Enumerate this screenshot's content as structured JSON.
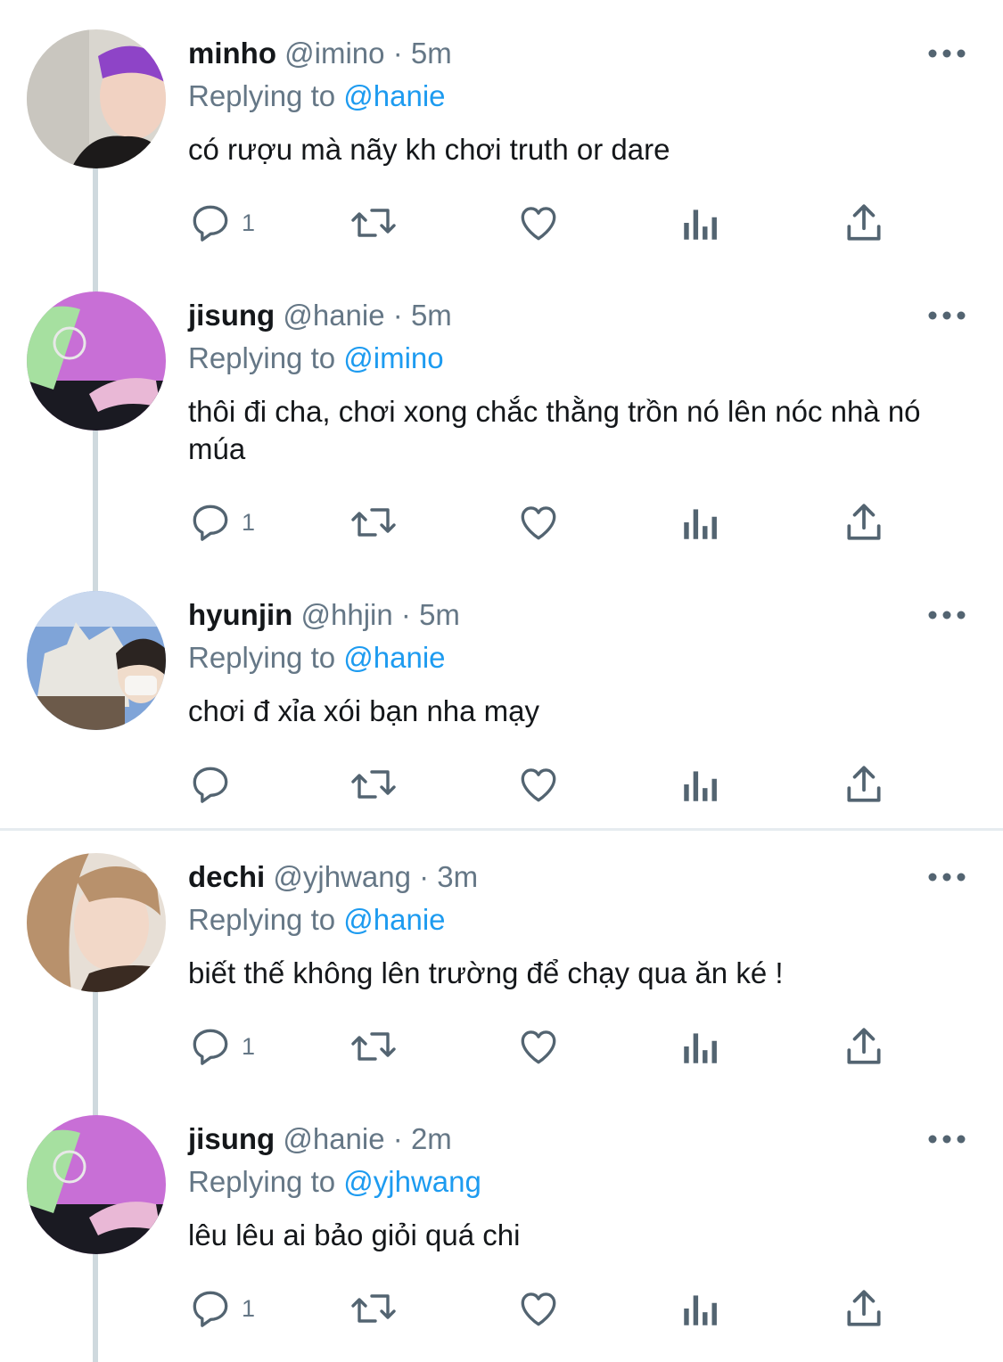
{
  "tweets": [
    {
      "name": "minho",
      "handle": "@imino",
      "separator": "·",
      "time": "5m",
      "replying_prefix": "Replying to",
      "replying_to": "@hanie",
      "text": "có rượu mà nãy kh chơi truth or dare",
      "reply_count": "1",
      "retweet_count": "",
      "like_count": "",
      "avatar_colors": [
        "#d9d6cf",
        "#1c1a1a",
        "#8e44c7"
      ]
    },
    {
      "name": "jisung",
      "handle": "@hanie",
      "separator": "·",
      "time": "5m",
      "replying_prefix": "Replying to",
      "replying_to": "@imino",
      "text": "thôi đi cha, chơi xong chắc thằng trồn nó lên nóc nhà nó múa",
      "reply_count": "1",
      "retweet_count": "",
      "like_count": "",
      "avatar_colors": [
        "#c86fd6",
        "#1a1a22",
        "#a6e0a0"
      ]
    },
    {
      "name": "hyunjin",
      "handle": "@hhjin",
      "separator": "·",
      "time": "5m",
      "replying_prefix": "Replying to",
      "replying_to": "@hanie",
      "text": "chơi đ xỉa xói bạn nha mạy",
      "reply_count": "",
      "retweet_count": "",
      "like_count": "",
      "avatar_colors": [
        "#7fa4d8",
        "#e8e6e0",
        "#2b2421"
      ]
    },
    {
      "name": "dechi",
      "handle": "@yjhwang",
      "separator": "·",
      "time": "3m",
      "replying_prefix": "Replying to",
      "replying_to": "@hanie",
      "text": "biết thế không lên trường để chạy qua ăn ké !",
      "reply_count": "1",
      "retweet_count": "",
      "like_count": "",
      "avatar_colors": [
        "#b8916c",
        "#f2d8c8",
        "#3a2b22"
      ]
    },
    {
      "name": "jisung",
      "handle": "@hanie",
      "separator": "·",
      "time": "2m",
      "replying_prefix": "Replying to",
      "replying_to": "@yjhwang",
      "text": "lêu lêu ai bảo giỏi quá chi",
      "reply_count": "1",
      "retweet_count": "",
      "like_count": "",
      "avatar_colors": [
        "#c86fd6",
        "#1a1a22",
        "#a6e0a0"
      ]
    }
  ],
  "icons": {
    "reply": "reply-icon",
    "retweet": "retweet-icon",
    "like": "like-icon",
    "analytics": "analytics-icon",
    "share": "share-icon",
    "more": "more-icon"
  },
  "colors": {
    "name": "#14171a",
    "muted": "#657786",
    "link": "#1d9bf0",
    "thread_line": "#cfd9de",
    "separator": "#e6ecf0"
  }
}
